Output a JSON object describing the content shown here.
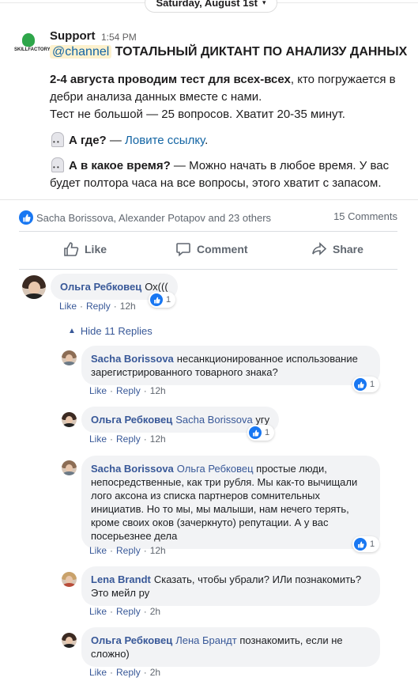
{
  "slack": {
    "date_label": "Saturday, August 1st",
    "sender": "Support",
    "time": "1:54 PM",
    "logo_text": "SKILLFACTORY",
    "mention": "@channel",
    "headline": "ТОТАЛЬНЫЙ ДИКТАНТ ПО АНАЛИЗУ ДАННЫХ",
    "p1_bold": "2-4 августа проводим тест для всех-всех",
    "p1_rest": ", кто погружается в",
    "p1_line2": "дебри анализа данных вместе с нами.",
    "p1_line3": "Тест не большой — 25 вопросов. Хватит 20-35 минут.",
    "p2_bold": "А где?",
    "p2_dash": " — ",
    "p2_link": "Ловите ссылку",
    "p2_end": ".",
    "p3_bold": "А в какое время?",
    "p3_rest": " — Можно начать в любое время. У вас",
    "p3_line2": "будет полтора часа на все вопросы, этого хватит с запасом."
  },
  "post": {
    "reactors": "Sacha Borissova, Alexander Potapov and 23 others",
    "comments_count": "15 Comments",
    "like_label": "Like",
    "comment_label": "Comment",
    "share_label": "Share"
  },
  "comments": {
    "c1": {
      "author": "Ольга Ребковец",
      "text": "Ох(((",
      "time": "12h",
      "reactions": "1"
    },
    "hide_replies": "Hide 11 Replies",
    "r1": {
      "author": "Sacha Borissova",
      "line1": "несанкционированное использование",
      "line2": "зарегистрированного товарного знака?",
      "time": "12h",
      "reactions": "1"
    },
    "r2": {
      "author": "Ольга Ребковец",
      "tag": "Sacha Borissova",
      "text": "угу",
      "time": "12h",
      "reactions": "1"
    },
    "r3": {
      "author": "Sacha Borissova",
      "tag": "Ольга Ребковец",
      "line1": "простые люди,",
      "line2": "непосредственные, как три рубля. Мы как-то вычищали",
      "line3": "лого аксона из списка партнеров сомнительных",
      "line4": "инициатив. Но то мы, мы малыши, нам нечего терять,",
      "line5": "кроме своих оков (зачеркнуто) репутации. А у вас",
      "line6": "посерьезнее дела",
      "time": "12h",
      "reactions": "1"
    },
    "r4": {
      "author": "Lena Brandt",
      "line1": "Сказать, чтобы убрали? ИЛи познакомить?",
      "line2": "Это мейл ру",
      "time": "2h"
    },
    "r5": {
      "author": "Ольга Ребковец",
      "tag": "Лена Брандт",
      "line1": "познакомить, если не",
      "line2": "сложно)",
      "time": "2h"
    },
    "like": "Like",
    "reply": "Reply",
    "sep": "·"
  },
  "colors": {
    "link": "#385898",
    "fb_blue": "#1877f2",
    "bubble": "#f2f3f5"
  }
}
